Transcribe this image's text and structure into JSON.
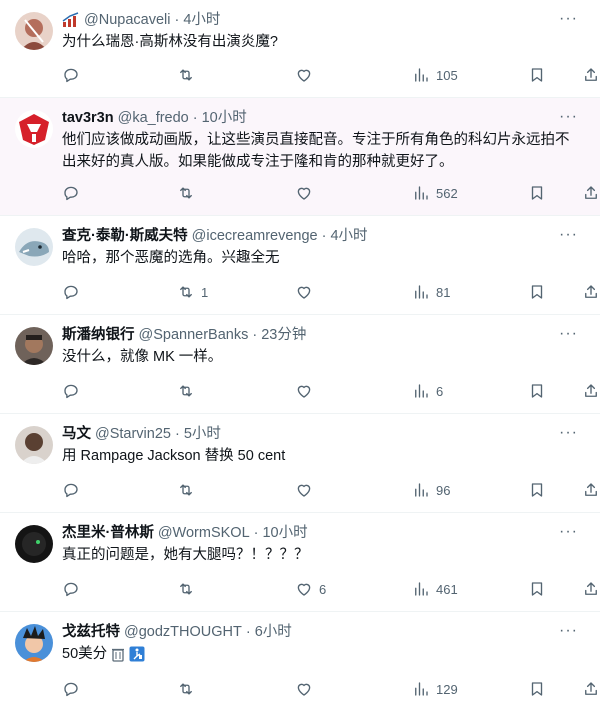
{
  "tweets": [
    {
      "name": "",
      "handle": "@Nupacaveli",
      "time": "4小时",
      "text": "为什么瑞恩·高斯林没有出演炎魔?",
      "replies": "",
      "retweets": "",
      "likes": "",
      "views": "105",
      "avatar_color": "#c98b7b"
    },
    {
      "name": "tav3r3n",
      "handle": "@ka_fredo",
      "time": "10小时",
      "text": "他们应该做成动画版，让这些演员直接配音。专注于所有角色的科幻片永远拍不出来好的真人版。如果能做成专注于隆和肯的那种就更好了。",
      "replies": "",
      "retweets": "",
      "likes": "",
      "views": "562",
      "avatar_color": "#d6202a"
    },
    {
      "name": "查克·泰勒·斯威夫特",
      "handle": "@icecreamrevenge",
      "time": "4小时",
      "text": "哈哈，那个恶魔的选角。兴趣全无",
      "replies": "",
      "retweets": "1",
      "likes": "",
      "views": "81",
      "avatar_color": "#8aa7b8"
    },
    {
      "name": "斯潘纳银行",
      "handle": "@SpannerBanks",
      "time": "23分钟",
      "text": "没什么，就像 MK 一样。",
      "replies": "",
      "retweets": "",
      "likes": "",
      "views": "6",
      "avatar_color": "#4a3d36"
    },
    {
      "name": "马文",
      "handle": "@Starvin25",
      "time": "5小时",
      "text": "用 Rampage Jackson 替换 50 cent",
      "replies": "",
      "retweets": "",
      "likes": "",
      "views": "96",
      "avatar_color": "#6b5446"
    },
    {
      "name": "杰里米·普林斯",
      "handle": "@WormSKOL",
      "time": "10小时",
      "text": "真正的问题是，她有大腿吗？！？？？",
      "replies": "",
      "retweets": "",
      "likes": "6",
      "views": "461",
      "avatar_color": "#1d1d1d"
    },
    {
      "name": "戈兹托特",
      "handle": "@godzTHOUGHT",
      "time": "6小时",
      "text": "50美分",
      "replies": "",
      "retweets": "",
      "likes": "",
      "views": "129",
      "avatar_color": "#7a4a8c"
    }
  ],
  "icons": {
    "reply": "reply-icon",
    "retweet": "retweet-icon",
    "like": "heart-icon",
    "views": "views-icon",
    "bookmark": "bookmark-icon",
    "share": "share-icon",
    "more": "more-icon"
  }
}
